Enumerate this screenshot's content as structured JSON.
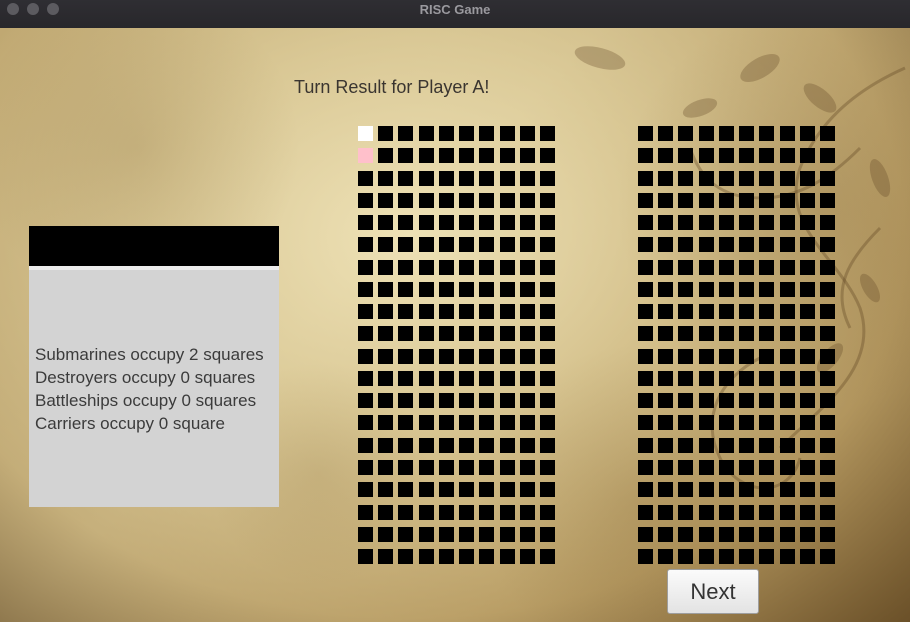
{
  "window": {
    "title": "RISC Game"
  },
  "turn_title": "Turn Result for Player A!",
  "info_panel": {
    "header_text": "",
    "lines": [
      "Submarines occupy 2 squares",
      "Destroyers occupy 0 squares",
      "Battleships occupy 0 squares",
      "Carriers occupy 0 square"
    ]
  },
  "boards": {
    "rows": 20,
    "cols": 10,
    "left_board": {
      "special_cells": [
        {
          "row": 0,
          "col": 0,
          "state": "white"
        },
        {
          "row": 1,
          "col": 0,
          "state": "pink"
        }
      ]
    },
    "right_board": {
      "special_cells": []
    }
  },
  "next_button": {
    "label": "Next"
  },
  "colors": {
    "cell_default": "#000000",
    "cell_white": "#ffffff",
    "cell_pink": "#ffc0cb",
    "panel_bg": "#d3d3d3"
  }
}
